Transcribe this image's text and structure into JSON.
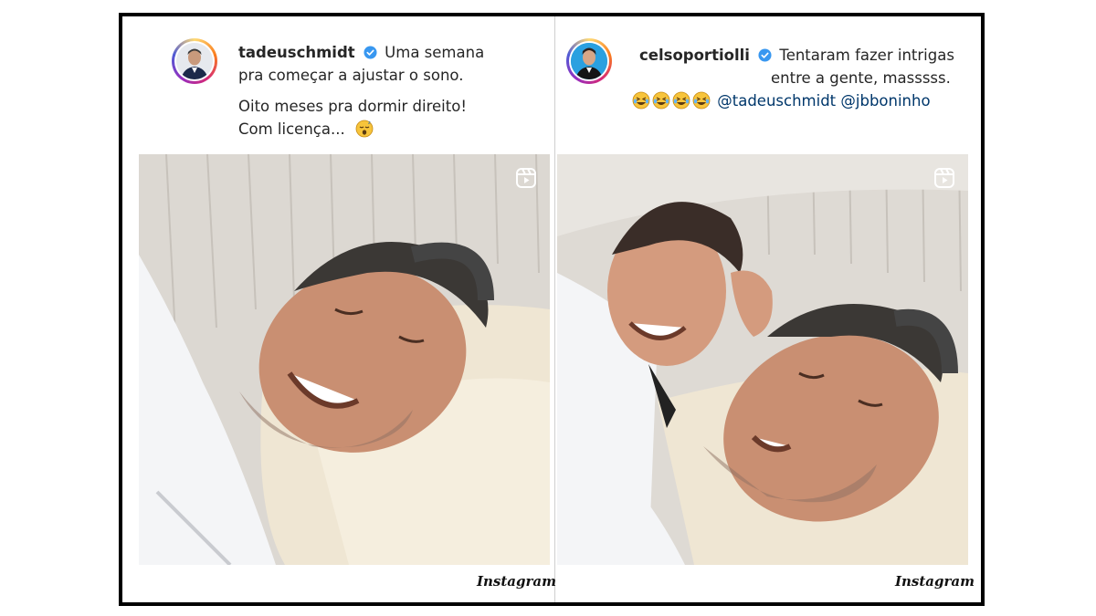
{
  "posts": [
    {
      "username": "tadeuschmidt",
      "verified": true,
      "caption_lines": [
        "Uma semana",
        "pra começar a ajustar o sono."
      ],
      "caption_lines_2": [
        "Oito meses pra dormir direito!",
        "Com licença..."
      ],
      "emoji": [
        "sleeping-face-emoji"
      ],
      "media_type": "reel",
      "footer_brand": "Instagram"
    },
    {
      "username": "celsoportiolli",
      "verified": true,
      "caption_lines": [
        "Tentaram fazer intrigas",
        "entre a gente, masssss."
      ],
      "emoji": [
        "laughing-tears-emoji",
        "laughing-tears-emoji",
        "laughing-tears-emoji",
        "laughing-tears-emoji"
      ],
      "mentions": [
        "@tadeuschmidt",
        "@jbboninho"
      ],
      "media_type": "reel",
      "footer_brand": "Instagram"
    }
  ],
  "colors": {
    "frame": "#000000",
    "text": "#262626",
    "mention": "#00376b",
    "verified": "#3897f0"
  }
}
